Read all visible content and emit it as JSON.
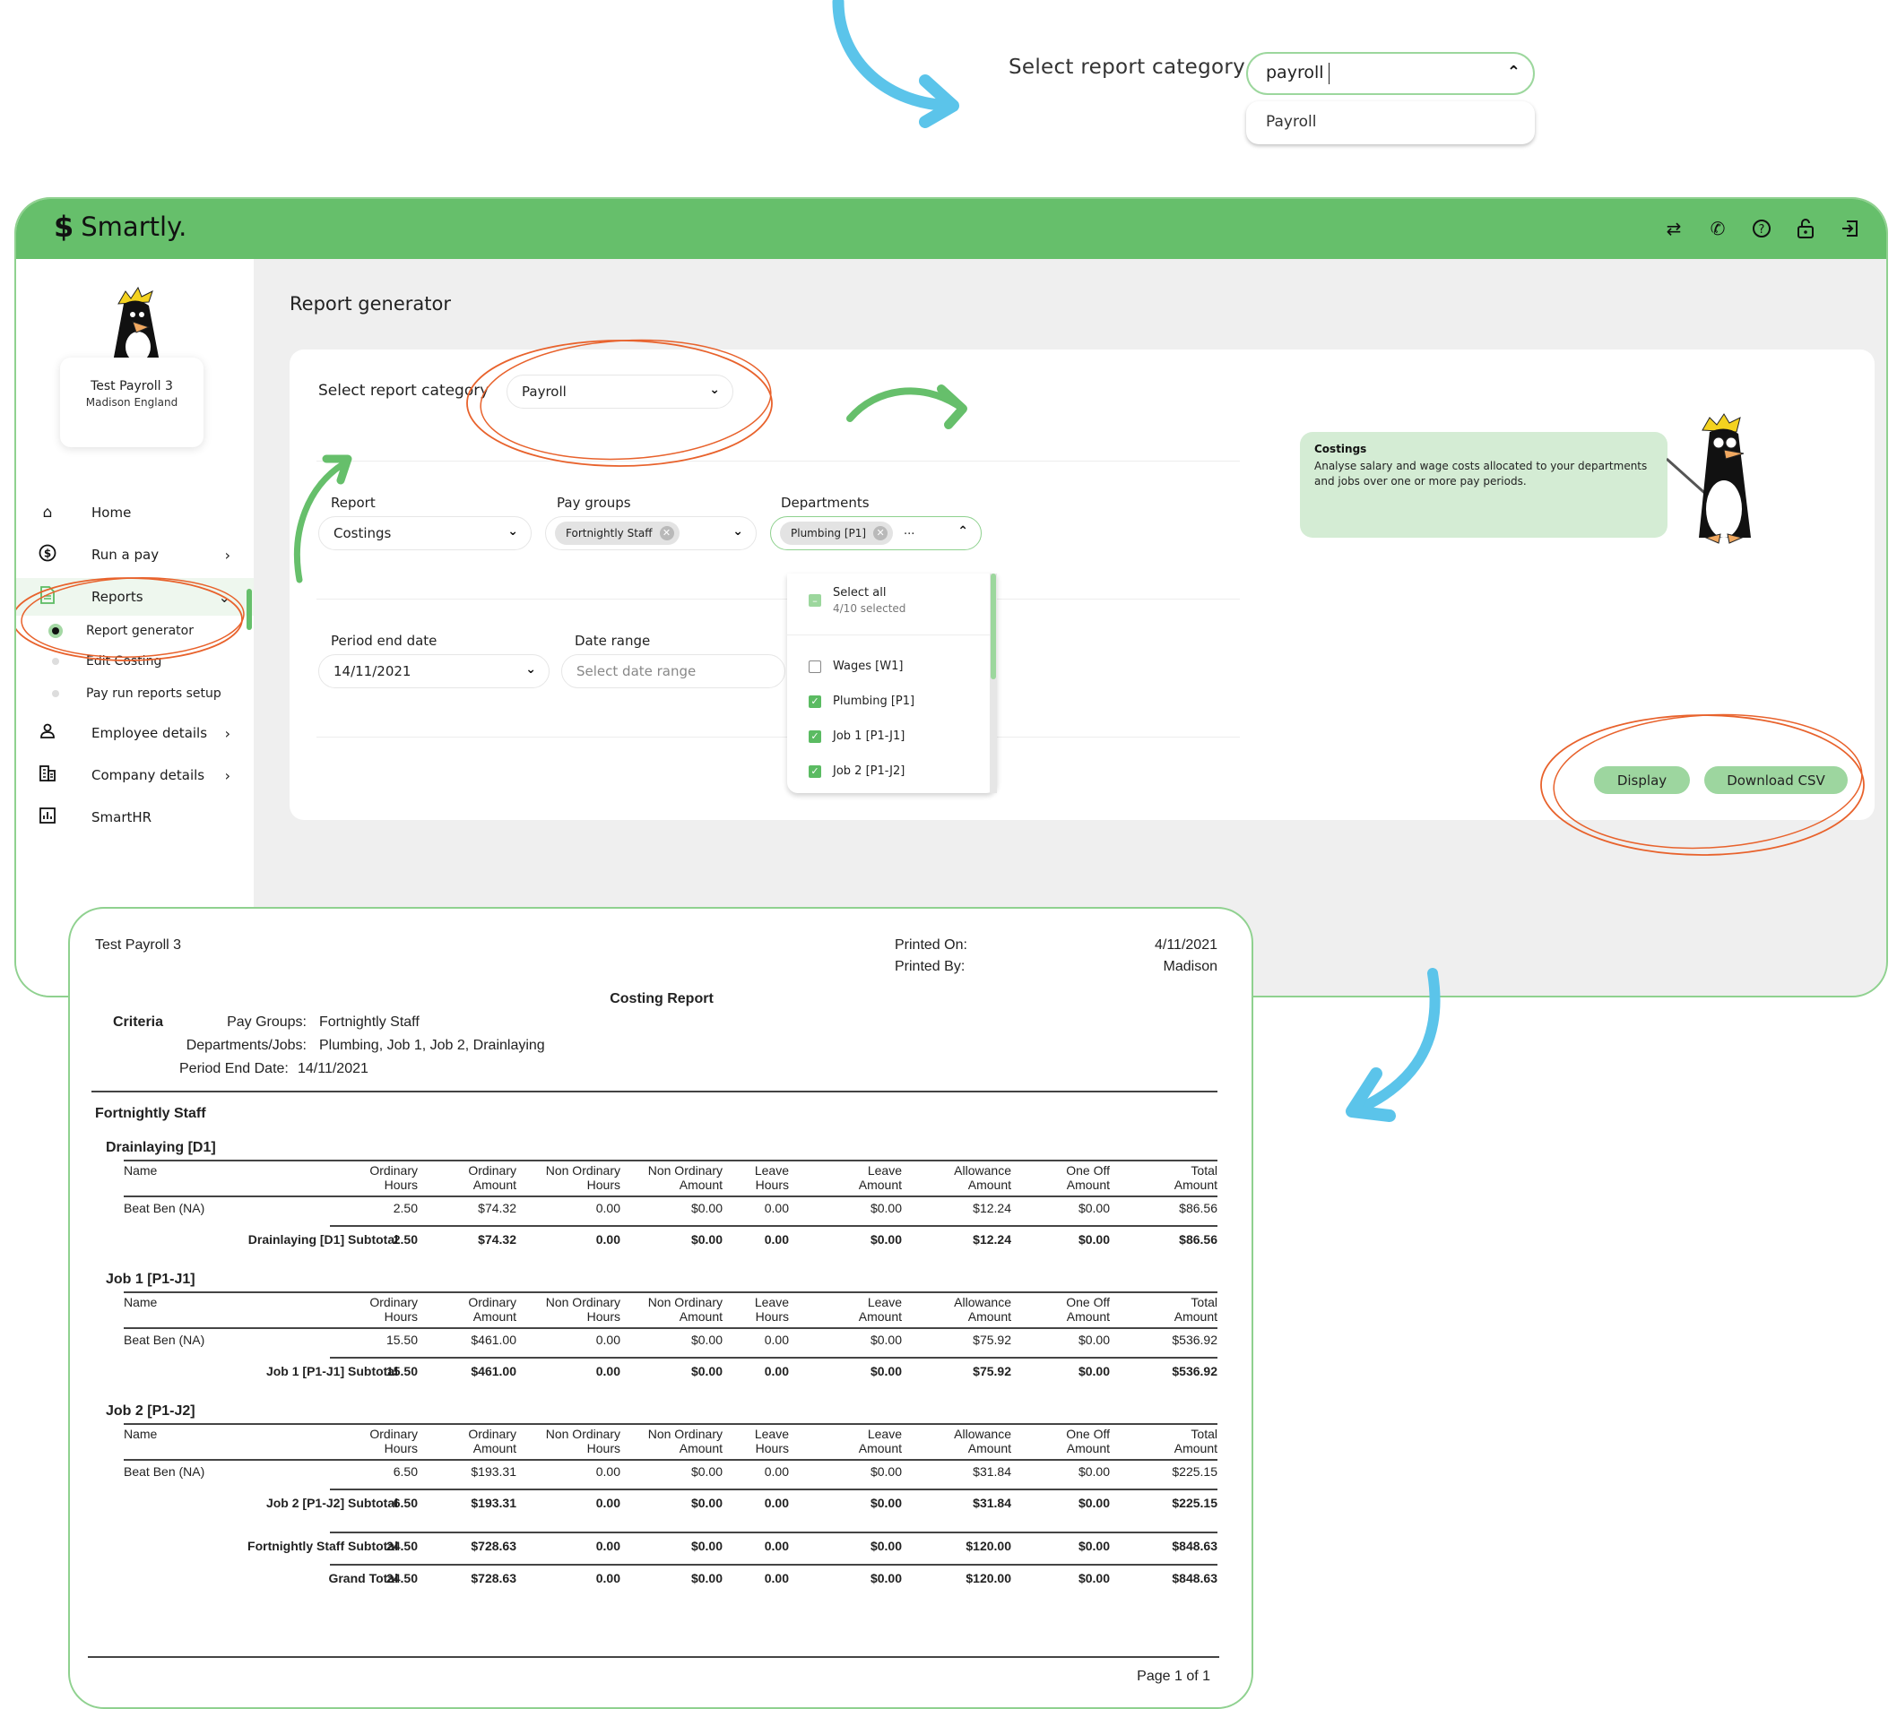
{
  "top_combo": {
    "label": "Select report category",
    "input_value": "payroll",
    "option": "Payroll"
  },
  "app": {
    "brand": "Smartly.",
    "header_icons": [
      "switch-icon",
      "phone-icon",
      "help-icon",
      "lock-icon",
      "logout-icon"
    ],
    "profile": {
      "company": "Test Payroll 3",
      "user": "Madison England"
    },
    "nav": [
      {
        "label": "Home",
        "icon": "home-icon"
      },
      {
        "label": "Run a pay",
        "icon": "dollar-icon",
        "has_children": true
      },
      {
        "label": "Reports",
        "icon": "report-icon",
        "expanded": true,
        "active": true
      },
      {
        "label": "Employee details",
        "icon": "person-icon",
        "has_children": true
      },
      {
        "label": "Company details",
        "icon": "building-icon",
        "has_children": true
      },
      {
        "label": "SmartHR",
        "icon": "chart-icon"
      }
    ],
    "subnav": [
      {
        "label": "Report generator",
        "active": true
      },
      {
        "label": "Edit Costing"
      },
      {
        "label": "Pay run reports setup"
      }
    ],
    "page_title": "Report generator",
    "form": {
      "category_label": "Select report category",
      "category_value": "Payroll",
      "report_label": "Report",
      "report_value": "Costings",
      "paygroups_label": "Pay groups",
      "paygroups_chip": "Fortnightly Staff",
      "departments_label": "Departments",
      "departments_chip": "Plumbing [P1]",
      "departments_more": "...",
      "period_label": "Period end date",
      "period_value": "14/11/2021",
      "daterange_label": "Date range",
      "daterange_placeholder": "Select date range"
    },
    "departments_dropdown": {
      "select_all": "Select all",
      "selected_count": "4/10 selected",
      "options": [
        {
          "label": "Wages [W1]",
          "checked": false
        },
        {
          "label": "Plumbing [P1]",
          "checked": true
        },
        {
          "label": "Job 1 [P1-J1]",
          "checked": true
        },
        {
          "label": "Job 2 [P1-J2]",
          "checked": true
        }
      ]
    },
    "info": {
      "title": "Costings",
      "description": "Analyse salary and wage costs allocated to your departments and jobs over one or more pay periods."
    },
    "buttons": {
      "display": "Display",
      "download": "Download CSV"
    }
  },
  "report": {
    "company": "Test Payroll 3",
    "printed_on_label": "Printed On:",
    "printed_on": "4/11/2021",
    "printed_by_label": "Printed By:",
    "printed_by": "Madison",
    "title": "Costing Report",
    "criteria_label": "Criteria",
    "criteria": [
      {
        "label": "Pay Groups:",
        "value": "Fortnightly Staff"
      },
      {
        "label": "Departments/Jobs:",
        "value": "Plumbing, Job 1, Job 2, Drainlaying"
      },
      {
        "label": "Period End Date:",
        "value": "14/11/2021"
      }
    ],
    "group": "Fortnightly Staff",
    "columns": [
      [
        "Name",
        ""
      ],
      [
        "Ordinary",
        "Hours"
      ],
      [
        "Ordinary",
        "Amount"
      ],
      [
        "Non Ordinary",
        "Hours"
      ],
      [
        "Non Ordinary",
        "Amount"
      ],
      [
        "Leave",
        "Hours"
      ],
      [
        "Leave",
        "Amount"
      ],
      [
        "Allowance",
        "Amount"
      ],
      [
        "One Off",
        "Amount"
      ],
      [
        "Total",
        "Amount"
      ]
    ],
    "sections": [
      {
        "title": "Drainlaying [D1]",
        "row": [
          "Beat Ben (NA)",
          "2.50",
          "$74.32",
          "0.00",
          "$0.00",
          "0.00",
          "$0.00",
          "$12.24",
          "$0.00",
          "$86.56"
        ],
        "subtotal": [
          "Drainlaying [D1] Subtotal",
          "2.50",
          "$74.32",
          "0.00",
          "$0.00",
          "0.00",
          "$0.00",
          "$12.24",
          "$0.00",
          "$86.56"
        ]
      },
      {
        "title": "Job 1 [P1-J1]",
        "row": [
          "Beat Ben (NA)",
          "15.50",
          "$461.00",
          "0.00",
          "$0.00",
          "0.00",
          "$0.00",
          "$75.92",
          "$0.00",
          "$536.92"
        ],
        "subtotal": [
          "Job 1 [P1-J1] Subtotal",
          "15.50",
          "$461.00",
          "0.00",
          "$0.00",
          "0.00",
          "$0.00",
          "$75.92",
          "$0.00",
          "$536.92"
        ]
      },
      {
        "title": "Job 2 [P1-J2]",
        "row": [
          "Beat Ben (NA)",
          "6.50",
          "$193.31",
          "0.00",
          "$0.00",
          "0.00",
          "$0.00",
          "$31.84",
          "$0.00",
          "$225.15"
        ],
        "subtotal": [
          "Job 2 [P1-J2] Subtotal",
          "6.50",
          "$193.31",
          "0.00",
          "$0.00",
          "0.00",
          "$0.00",
          "$31.84",
          "$0.00",
          "$225.15"
        ]
      }
    ],
    "group_subtotal": [
      "Fortnightly Staff Subtotal",
      "24.50",
      "$728.63",
      "0.00",
      "$0.00",
      "0.00",
      "$0.00",
      "$120.00",
      "$0.00",
      "$848.63"
    ],
    "grand_total": [
      "Grand Total",
      "24.50",
      "$728.63",
      "0.00",
      "$0.00",
      "0.00",
      "$0.00",
      "$120.00",
      "$0.00",
      "$848.63"
    ],
    "footer": "Page 1 of 1"
  },
  "colors": {
    "brand_green": "#66bf6b",
    "annotation_orange": "#e8622c",
    "annotation_blue": "#5bc4ea"
  }
}
